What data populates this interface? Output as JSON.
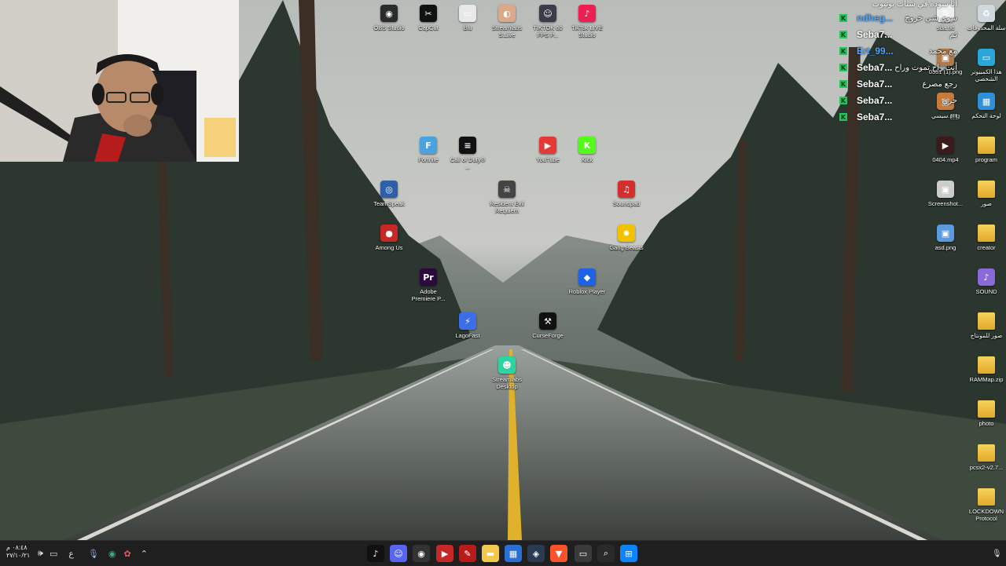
{
  "desktop": {
    "icons": [
      {
        "label": "OBS Studio",
        "icon": "obs-icon",
        "color": "#2b2b2b",
        "glyph": "◉"
      },
      {
        "label": "CapCut",
        "icon": "capcut-icon",
        "color": "#111111",
        "glyph": "✂"
      },
      {
        "label": "Blu",
        "icon": "file-icon",
        "color": "#e8e8e8",
        "glyph": "▭"
      },
      {
        "label": "Streamlabs S.Live",
        "icon": "streamlabs-icon",
        "color": "#d9a98a",
        "glyph": "◐"
      },
      {
        "label": "TIKTOK 60 FPS P...",
        "icon": "tiktok-thumb-icon",
        "color": "#3b3b4a",
        "glyph": "☺"
      },
      {
        "label": "TikTok LIVE Studio",
        "icon": "tiktok-live-icon",
        "color": "#ee1d52",
        "glyph": "♪"
      },
      {
        "label": "Fortnite",
        "icon": "fortnite-icon",
        "color": "#4aa3df",
        "glyph": "F"
      },
      {
        "label": "Call of Duty® ...",
        "icon": "cod-icon",
        "color": "#111111",
        "glyph": "≡"
      },
      {
        "label": "YouTube",
        "icon": "youtube-icon",
        "color": "#e53935",
        "glyph": "▶"
      },
      {
        "label": "Kick",
        "icon": "kick-icon",
        "color": "#53fc18",
        "glyph": "K"
      },
      {
        "label": "TeamSpeak",
        "icon": "teamspeak-icon",
        "color": "#2f5fa8",
        "glyph": "◎"
      },
      {
        "label": "Resident Evil Requiem",
        "icon": "re-icon",
        "color": "#444444",
        "glyph": "☠"
      },
      {
        "label": "Soundpad",
        "icon": "soundpad-icon",
        "color": "#d32f2f",
        "glyph": "♫"
      },
      {
        "label": "Among Us",
        "icon": "amongus-icon",
        "color": "#c62828",
        "glyph": "●"
      },
      {
        "label": "Gang Beasts",
        "icon": "gangbeasts-icon",
        "color": "#f2c200",
        "glyph": "✸"
      },
      {
        "label": "Adobe Premiere P...",
        "icon": "premiere-icon",
        "color": "#2a0a3c",
        "glyph": "Pr"
      },
      {
        "label": "Roblox Player",
        "icon": "roblox-icon",
        "color": "#1e63e6",
        "glyph": "◆"
      },
      {
        "label": "LagoFast",
        "icon": "lagofast-icon",
        "color": "#3b6ee8",
        "glyph": "⚡"
      },
      {
        "label": "CurseForge",
        "icon": "curseforge-icon",
        "color": "#111111",
        "glyph": "⚒"
      },
      {
        "label": "Streamlabs Desktop",
        "icon": "streamlabs-desktop-icon",
        "color": "#2bd4a0",
        "glyph": "☻"
      }
    ],
    "right_icons": [
      {
        "label": "sda.txt",
        "icon": "text-file-icon",
        "color": "#eeeeee",
        "glyph": "≣",
        "folder": false
      },
      {
        "label": "سلة المحذوفات",
        "icon": "recycle-bin-icon",
        "color": "#cfd8dc",
        "glyph": "♻",
        "folder": false
      },
      {
        "label": "0331 (1).png",
        "icon": "image-file-icon",
        "color": "#b07a4a",
        "glyph": "▣",
        "folder": false
      },
      {
        "label": "هذا الكمبيوتر الشخصي",
        "icon": "computer-icon",
        "color": "#2aa7d8",
        "glyph": "▭",
        "folder": false
      },
      {
        "label": "سيسي.png",
        "icon": "image-file-icon",
        "color": "#c97a3a",
        "glyph": "▣",
        "folder": false
      },
      {
        "label": "لوحة التحكم",
        "icon": "control-panel-icon",
        "color": "#2f8fd8",
        "glyph": "▦",
        "folder": false
      },
      {
        "label": "0404.mp4",
        "icon": "video-file-icon",
        "color": "#3a1a1a",
        "glyph": "▶",
        "folder": false
      },
      {
        "label": "program",
        "icon": "folder-icon",
        "color": "#f2c94c",
        "glyph": "",
        "folder": true
      },
      {
        "label": "Screenshot...",
        "icon": "screenshot-file-icon",
        "color": "#cccccc",
        "glyph": "▣",
        "folder": false
      },
      {
        "label": "صور",
        "icon": "folder-icon",
        "color": "#f2c94c",
        "glyph": "",
        "folder": true
      },
      {
        "label": "asd.png",
        "icon": "image-file-icon",
        "color": "#5a9adf",
        "glyph": "▣",
        "folder": false
      },
      {
        "label": "creator",
        "icon": "folder-icon",
        "color": "#f2c94c",
        "glyph": "",
        "folder": true
      },
      {
        "label": "SOUND",
        "icon": "sound-folder-icon",
        "color": "#8a6ad8",
        "glyph": "♪",
        "folder": false
      },
      {
        "label": "صور للمونتاج",
        "icon": "folder-icon",
        "color": "#f2c94c",
        "glyph": "",
        "folder": true
      },
      {
        "label": "RAMMap.zip",
        "icon": "zip-folder-icon",
        "color": "#f2c94c",
        "glyph": "",
        "folder": true
      },
      {
        "label": "photo",
        "icon": "folder-icon",
        "color": "#f2c94c",
        "glyph": "",
        "folder": true
      },
      {
        "label": "pcsx2-v2.7...",
        "icon": "folder-icon",
        "color": "#f2c94c",
        "glyph": "",
        "folder": true
      },
      {
        "label": "LOCKDOWN Protocol",
        "icon": "folder-icon",
        "color": "#f2c94c",
        "glyph": "",
        "folder": true
      }
    ]
  },
  "chat": {
    "top_text": "أنا سوده في شباب يوتيوب",
    "messages": [
      {
        "user": "ndheg...",
        "msg": "سوي شي خروج"
      },
      {
        "user": "Seba7...",
        "msg": "ثم"
      },
      {
        "user": "Ert_99...",
        "msg": "مع محمد"
      },
      {
        "user": "Seba7...",
        "msg": "أنت راح تموت وراح"
      },
      {
        "user": "Seba7...",
        "msg": "رجع مصرع"
      },
      {
        "user": "Seba7...",
        "msg": "حري"
      },
      {
        "user": "Seba7...",
        "msg": "!!!"
      }
    ]
  },
  "taskbar": {
    "clock_time": "٠٨:٤٨ م",
    "clock_date": "٢٧/١٠/٢١",
    "lang": "ع",
    "apps": [
      {
        "icon": "tiktok-icon",
        "color": "#111111",
        "glyph": "♪"
      },
      {
        "icon": "discord-icon",
        "color": "#5865f2",
        "glyph": "☺"
      },
      {
        "icon": "obs-icon",
        "color": "#333333",
        "glyph": "◉"
      },
      {
        "icon": "video-app-icon",
        "color": "#c62828",
        "glyph": "▶"
      },
      {
        "icon": "pdf-icon",
        "color": "#b71c1c",
        "glyph": "✎"
      },
      {
        "icon": "file-explorer-icon",
        "color": "#f2c94c",
        "glyph": "▬"
      },
      {
        "icon": "store-icon",
        "color": "#2a6fd6",
        "glyph": "▦"
      },
      {
        "icon": "steam-icon",
        "color": "#2a3a52",
        "glyph": "◈"
      },
      {
        "icon": "brave-icon",
        "color": "#fb542b",
        "glyph": "▼"
      },
      {
        "icon": "task-view-icon",
        "color": "#3a3a3a",
        "glyph": "▭"
      },
      {
        "icon": "search-icon",
        "color": "#2a2a2a",
        "glyph": "⌕"
      },
      {
        "icon": "windows-start-icon",
        "color": "#0a84ff",
        "glyph": "⊞"
      }
    ]
  }
}
